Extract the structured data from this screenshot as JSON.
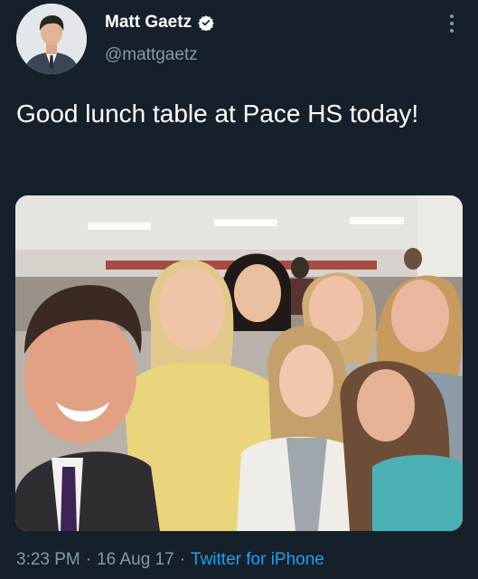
{
  "user": {
    "display_name": "Matt Gaetz",
    "handle": "@mattgaetz",
    "verified": true
  },
  "tweet": {
    "text": "Good lunch table at Pace HS today!",
    "media": {
      "type": "photo"
    }
  },
  "meta": {
    "time": "3:23 PM",
    "separator": "·",
    "date": "16 Aug 17",
    "source": "Twitter for iPhone"
  },
  "icons": {
    "verified": "verified-badge-icon",
    "more": "more-options-icon"
  },
  "colors": {
    "background": "#15202b",
    "secondary_text": "#8899a6",
    "link": "#1da1f2"
  }
}
